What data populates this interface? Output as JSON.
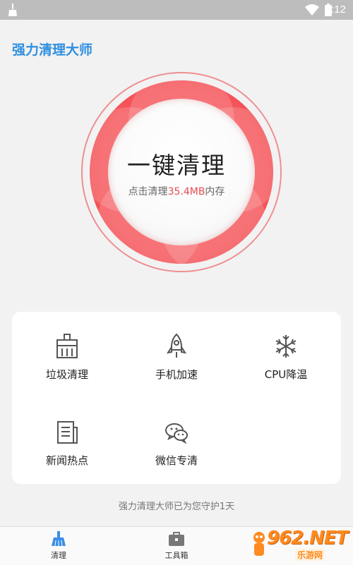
{
  "status_bar": {
    "time": "8:12"
  },
  "app_title": "强力清理大师",
  "clean_button": {
    "title": "一键清理",
    "hint_prefix": "点击清理",
    "hint_amount": "35.4MB",
    "hint_suffix": "内存"
  },
  "tools": [
    {
      "label": "垃圾清理",
      "icon": "trash-bin-icon"
    },
    {
      "label": "手机加速",
      "icon": "rocket-icon"
    },
    {
      "label": "CPU降温",
      "icon": "snowflake-icon"
    },
    {
      "label": "新闻热点",
      "icon": "newspaper-icon"
    },
    {
      "label": "微信专清",
      "icon": "wechat-icon"
    }
  ],
  "guard_text": "强力清理大师已为您守护1天",
  "bottom_nav": [
    {
      "label": "清理",
      "icon": "broom-icon",
      "active": true
    },
    {
      "label": "工具箱",
      "icon": "toolbox-icon",
      "active": false
    }
  ],
  "watermark": {
    "brand": "962.NET",
    "site": "乐游网"
  },
  "colors": {
    "accent_blue": "#2f8fe0",
    "accent_red": "#f0454b",
    "amount": "#e84c53"
  }
}
